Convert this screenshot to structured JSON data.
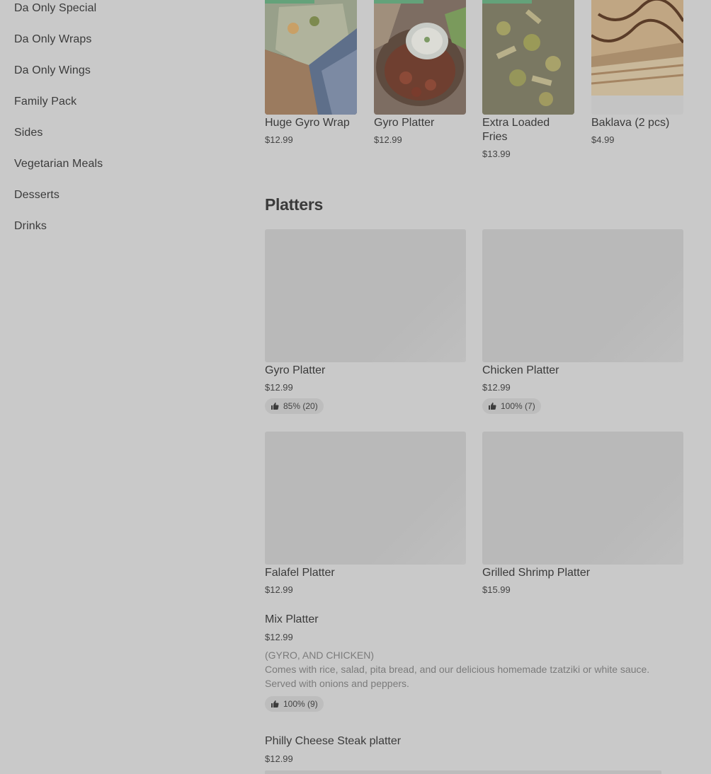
{
  "sidebar": {
    "items": [
      {
        "label": "Da Only Special"
      },
      {
        "label": "Da Only Wraps"
      },
      {
        "label": "Da Only Wings"
      },
      {
        "label": "Family Pack"
      },
      {
        "label": "Sides"
      },
      {
        "label": "Vegetarian Meals"
      },
      {
        "label": "Desserts"
      },
      {
        "label": "Drinks"
      }
    ]
  },
  "featured": {
    "items": [
      {
        "name": "Huge Gyro Wrap",
        "price": "$12.99"
      },
      {
        "name": "Gyro Platter",
        "price": "$12.99"
      },
      {
        "name": "Extra Loaded Fries",
        "price": "$13.99"
      },
      {
        "name": "Baklava (2 pcs)",
        "price": "$4.99"
      }
    ]
  },
  "platters": {
    "title": "Platters",
    "cards": [
      {
        "name": "Gyro Platter",
        "price": "$12.99",
        "rating": "85% (20)"
      },
      {
        "name": "Chicken Platter",
        "price": "$12.99",
        "rating": "100% (7)"
      },
      {
        "name": "Falafel Platter",
        "price": "$12.99"
      },
      {
        "name": "Grilled Shrimp Platter",
        "price": "$15.99"
      }
    ],
    "list": [
      {
        "name": "Mix Platter",
        "price": "$12.99",
        "desc_line1": "(GYRO, AND CHICKEN)",
        "desc_line2": "Comes with rice, salad, pita bread, and our delicious homemade tzatziki or white sauce.",
        "desc_line3": "Served with onions and peppers.",
        "rating": "100% (9)"
      },
      {
        "name": "Philly Cheese Steak platter",
        "price": "$12.99"
      }
    ]
  },
  "colors": {
    "background": "#c9c9c9",
    "placeholder": "#b9b9b9",
    "badge": "#bdbdbd",
    "text": "#3a3a3a"
  },
  "icons": {
    "rating": "thumbs-up-icon"
  }
}
